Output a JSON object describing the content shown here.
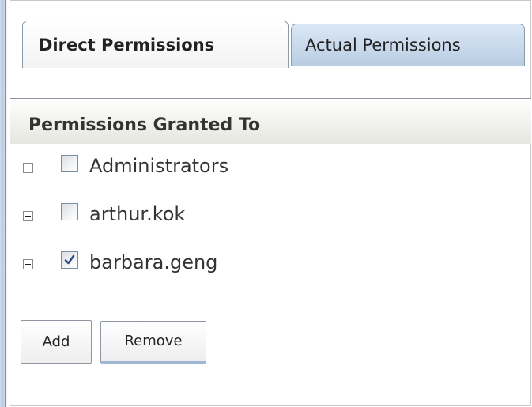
{
  "tabs": [
    {
      "label": "Direct Permissions",
      "active": true
    },
    {
      "label": "Actual Permissions",
      "active": false
    }
  ],
  "section": {
    "title": "Permissions Granted To"
  },
  "principals": [
    {
      "name": "Administrators",
      "checked": false,
      "expander": "plus"
    },
    {
      "name": "arthur.kok",
      "checked": false,
      "expander": "plus"
    },
    {
      "name": "barbara.geng",
      "checked": true,
      "expander": "plus"
    }
  ],
  "buttons": {
    "add_label": "Add",
    "remove_label": "Remove"
  },
  "colors": {
    "active_tab": "#ffffff",
    "inactive_tab": "#c8d9ec",
    "checkmark": "#2c4f8c",
    "rail": "#6d8fc0"
  }
}
